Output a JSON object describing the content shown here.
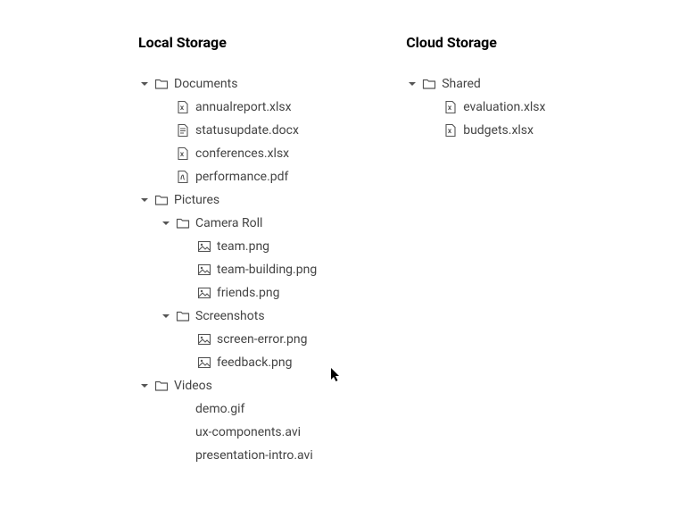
{
  "columns": [
    {
      "title": "Local Storage",
      "root": [
        {
          "type": "folder",
          "name": "Documents",
          "children": [
            {
              "type": "file",
              "icon": "xls",
              "name": "annualreport.xlsx"
            },
            {
              "type": "file",
              "icon": "doc",
              "name": "statusupdate.docx"
            },
            {
              "type": "file",
              "icon": "xls",
              "name": "conferences.xlsx"
            },
            {
              "type": "file",
              "icon": "pdf",
              "name": "performance.pdf"
            }
          ]
        },
        {
          "type": "folder",
          "name": "Pictures",
          "children": [
            {
              "type": "folder",
              "name": "Camera Roll",
              "children": [
                {
                  "type": "file",
                  "icon": "img",
                  "name": "team.png"
                },
                {
                  "type": "file",
                  "icon": "img",
                  "name": "team-building.png"
                },
                {
                  "type": "file",
                  "icon": "img",
                  "name": "friends.png"
                }
              ]
            },
            {
              "type": "folder",
              "name": "Screenshots",
              "children": [
                {
                  "type": "file",
                  "icon": "img",
                  "name": "screen-error.png"
                },
                {
                  "type": "file",
                  "icon": "img",
                  "name": "feedback.png"
                }
              ]
            }
          ]
        },
        {
          "type": "folder",
          "name": "Videos",
          "children": [
            {
              "type": "file",
              "icon": "none",
              "name": "demo.gif"
            },
            {
              "type": "file",
              "icon": "none",
              "name": "ux-components.avi"
            },
            {
              "type": "file",
              "icon": "none",
              "name": "presentation-intro.avi"
            }
          ]
        }
      ]
    },
    {
      "title": "Cloud Storage",
      "root": [
        {
          "type": "folder",
          "name": "Shared",
          "children": [
            {
              "type": "file",
              "icon": "xls",
              "name": "evaluation.xlsx"
            },
            {
              "type": "file",
              "icon": "xls",
              "name": "budgets.xlsx"
            }
          ]
        }
      ]
    }
  ]
}
